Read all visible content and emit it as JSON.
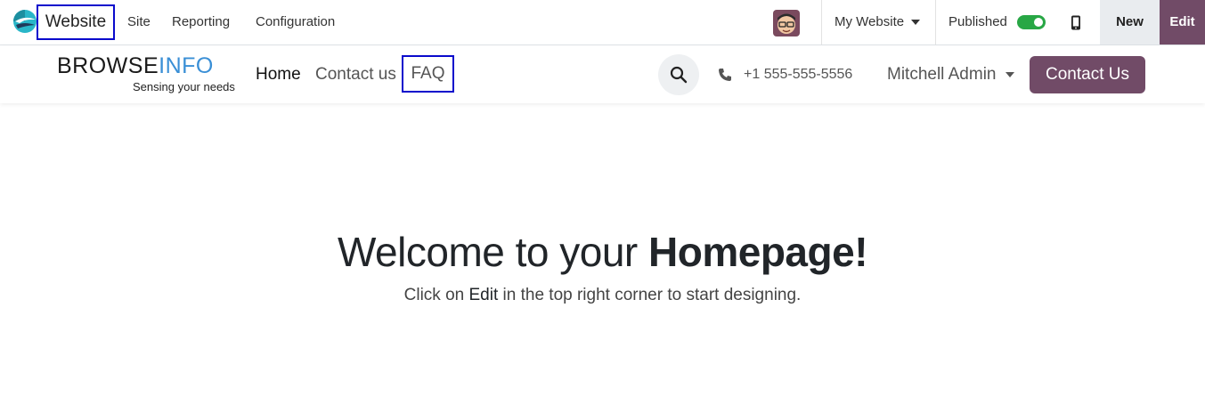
{
  "topbar": {
    "app_name": "Website",
    "menu": [
      "Site",
      "Reporting",
      "Configuration"
    ],
    "website_switch": "My Website",
    "published_label": "Published",
    "published": true,
    "new_label": "New",
    "edit_label": "Edit",
    "colors": {
      "brand": "#714b67",
      "toggle_on": "#28a745",
      "highlight_box": "#0a0acc"
    }
  },
  "header": {
    "logo": {
      "part1": "BROWSE",
      "part2": "INFO",
      "tagline": "Sensing your needs"
    },
    "nav": [
      "Home",
      "Contact us",
      "FAQ"
    ],
    "phone": "+1 555-555-5556",
    "user": "Mitchell Admin",
    "cta_label": "Contact Us"
  },
  "hero": {
    "title_plain": "Welcome to your ",
    "title_bold": "Homepage!",
    "sub_before": "Click on ",
    "sub_em": "Edit",
    "sub_after": " in the top right corner to start designing."
  }
}
